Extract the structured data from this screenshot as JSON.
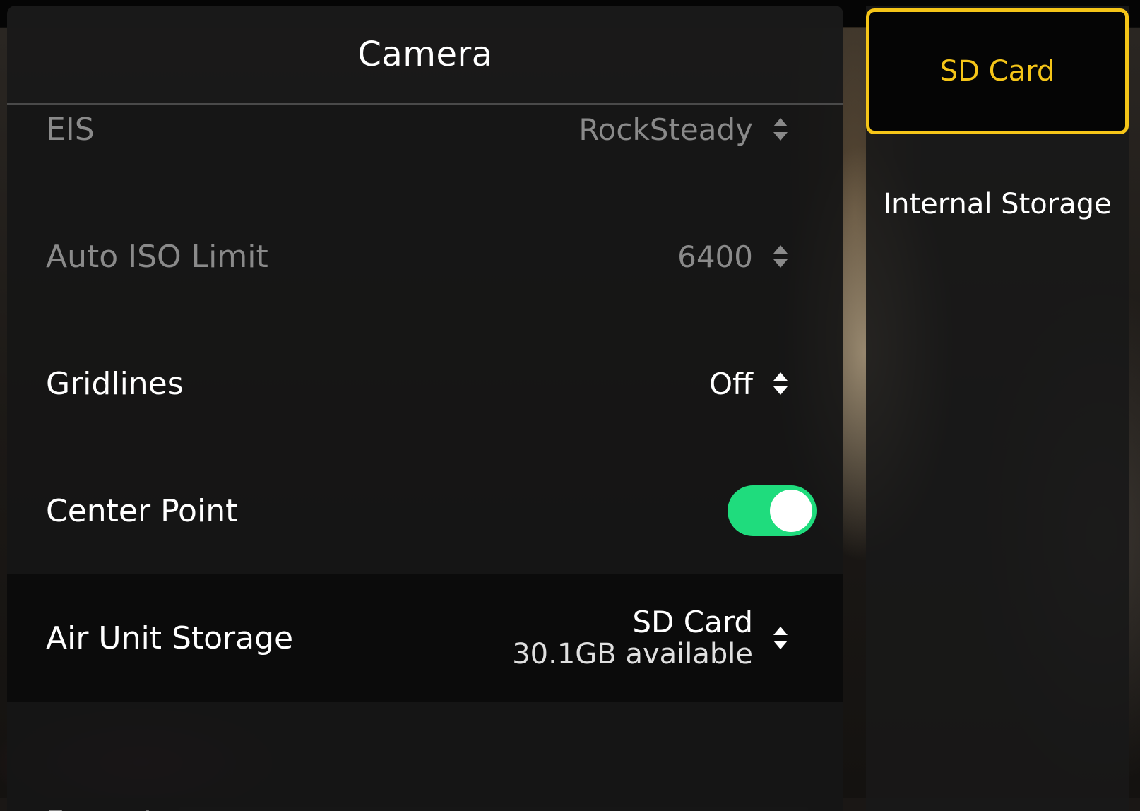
{
  "panel": {
    "title": "Camera"
  },
  "settings": [
    {
      "label": "EIS",
      "value": "RockSteady",
      "state": "disabled"
    },
    {
      "label": "Auto ISO Limit",
      "value": "6400",
      "state": "disabled"
    },
    {
      "label": "Gridlines",
      "value": "Off",
      "state": "enabled"
    },
    {
      "label": "Center Point",
      "toggle": "on",
      "state": "enabled"
    },
    {
      "label": "Air Unit Storage",
      "value": "SD Card",
      "detail": "30.1GB available",
      "state": "selected"
    },
    {
      "label": "Format",
      "state": "disabled"
    }
  ],
  "storage_picker": {
    "options": [
      "SD Card",
      "Internal Storage"
    ],
    "selected": "SD Card"
  },
  "colors": {
    "accent": "#f5c518",
    "toggle_on": "#1fdc7d",
    "panel_bg": "#161616",
    "dim_text": "#8a8a8a"
  },
  "icons": {
    "stepper": "up-down-arrows-icon"
  }
}
